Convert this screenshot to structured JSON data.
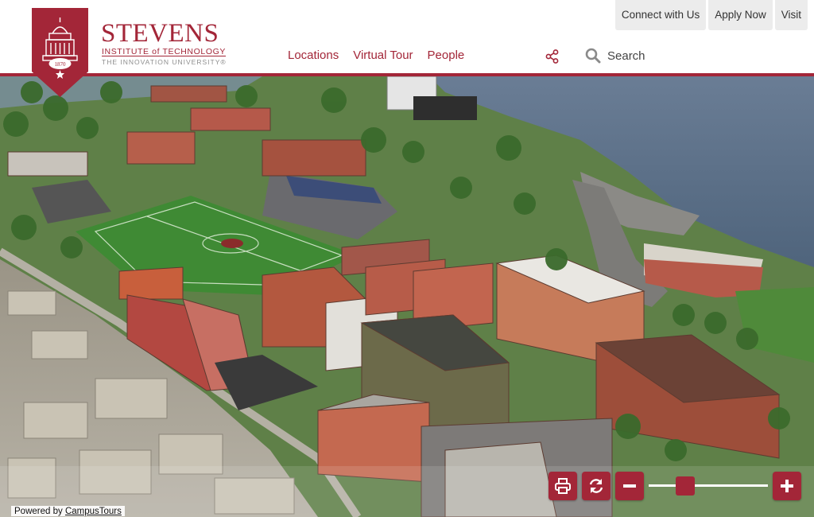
{
  "brand": {
    "name": "STEVENS",
    "subtitle": "INSTITUTE of TECHNOLOGY",
    "tagline": "THE INNOVATION UNIVERSITY®",
    "year": "1870",
    "color": "#a32638"
  },
  "nav": {
    "locations": "Locations",
    "virtual_tour": "Virtual Tour",
    "people": "People"
  },
  "search": {
    "label": "Search"
  },
  "top_links": {
    "connect": "Connect with Us",
    "apply": "Apply Now",
    "visit": "Visit"
  },
  "controls": {
    "zoom_level": 0.27,
    "print_icon": "print-icon",
    "reset_icon": "refresh-icon"
  },
  "footer": {
    "powered_prefix": "Powered by",
    "powered_link": "CampusTours"
  },
  "colors": {
    "accent": "#a32638",
    "water": "#5a6f8a",
    "turf": "#3f8a34"
  }
}
